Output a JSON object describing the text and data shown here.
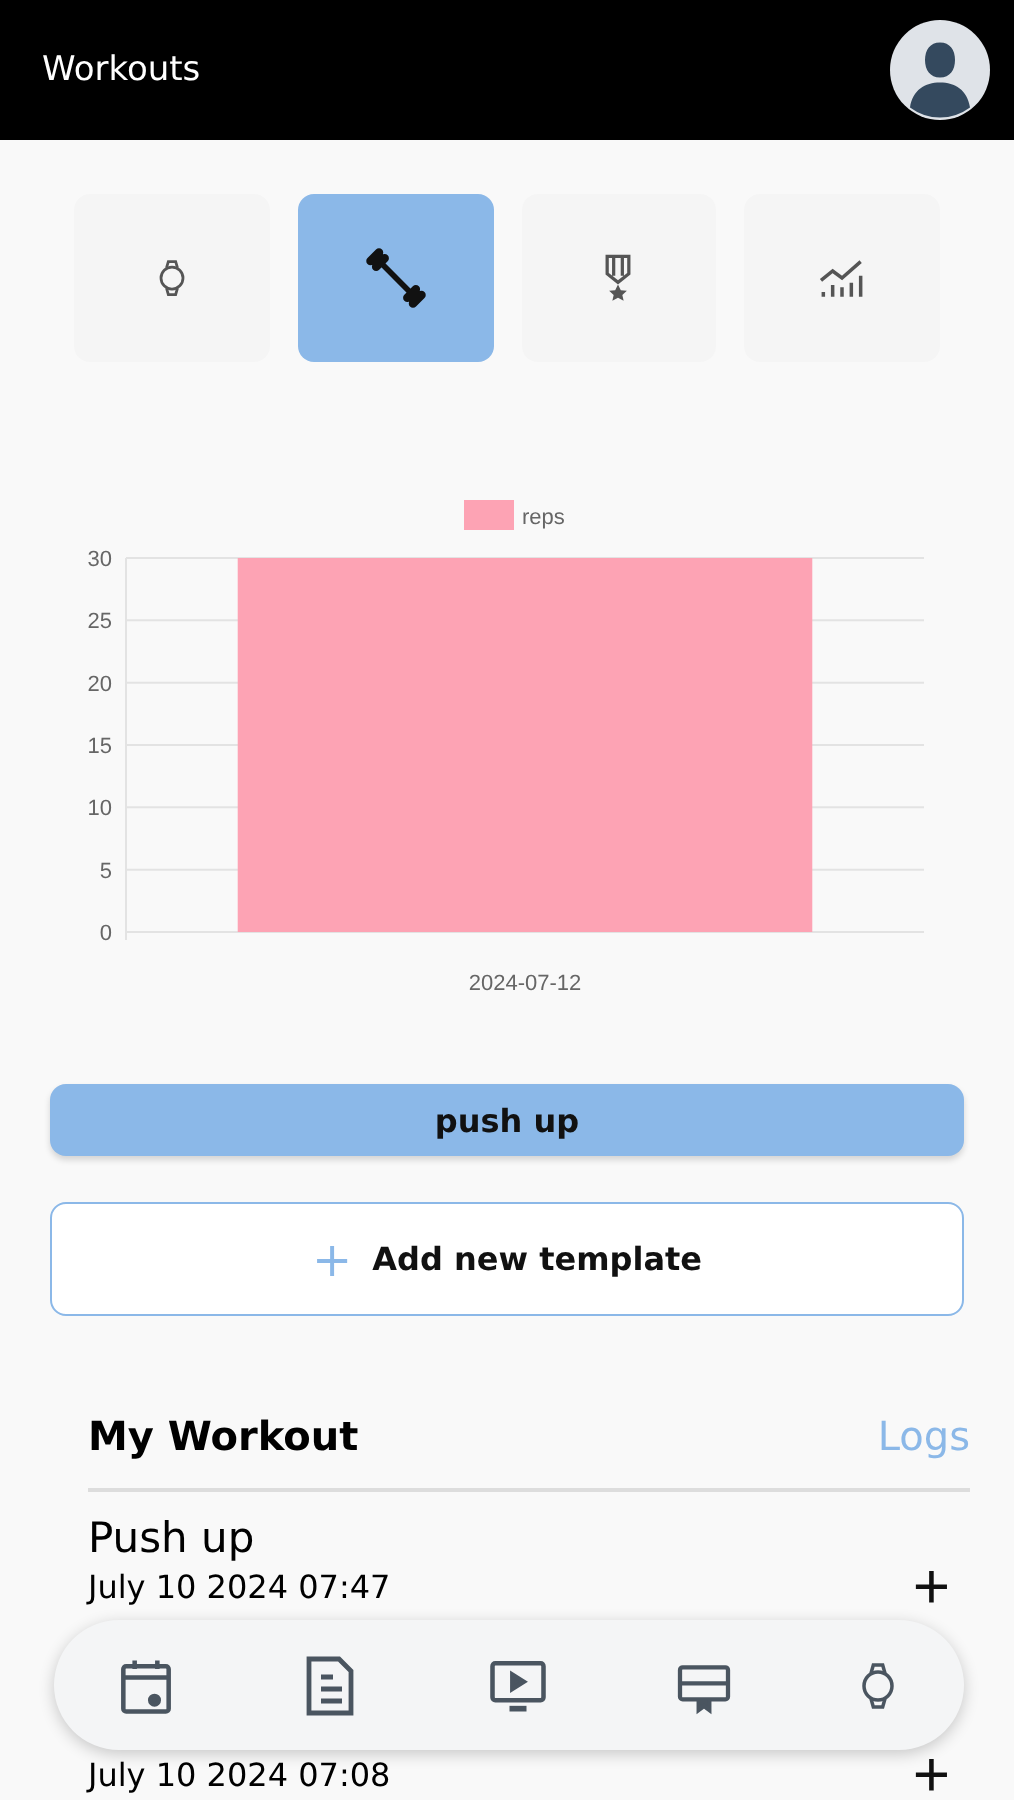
{
  "app_bar": {
    "title": "Workouts"
  },
  "tabs": [
    {
      "kind": "watch",
      "selected": false
    },
    {
      "kind": "dumbbell",
      "selected": true
    },
    {
      "kind": "medal",
      "selected": false
    },
    {
      "kind": "chart",
      "selected": false
    }
  ],
  "chart": {
    "chart_data": {
      "type": "bar",
      "grid": true,
      "categories": [
        "2024-07-12"
      ],
      "series": [
        {
          "name": "reps",
          "color": "#fda3b4",
          "values": [
            30
          ]
        }
      ],
      "ylim": [
        0,
        30
      ],
      "yticks": [
        0,
        5,
        10,
        15,
        20,
        25,
        30
      ]
    }
  },
  "template_button": "push up",
  "add_button": {
    "icon": "+",
    "label": "Add new template"
  },
  "section": {
    "title": "My Workout",
    "link": "Logs"
  },
  "workouts": [
    {
      "name": "Push up",
      "date": "July 10 2024 07:47",
      "action": "+"
    },
    {
      "date": "July 10 2024 07:08",
      "action": "+"
    }
  ],
  "bottom_nav": [
    {
      "kind": "calendar"
    },
    {
      "kind": "document"
    },
    {
      "kind": "video"
    },
    {
      "kind": "card"
    },
    {
      "kind": "watch"
    }
  ]
}
